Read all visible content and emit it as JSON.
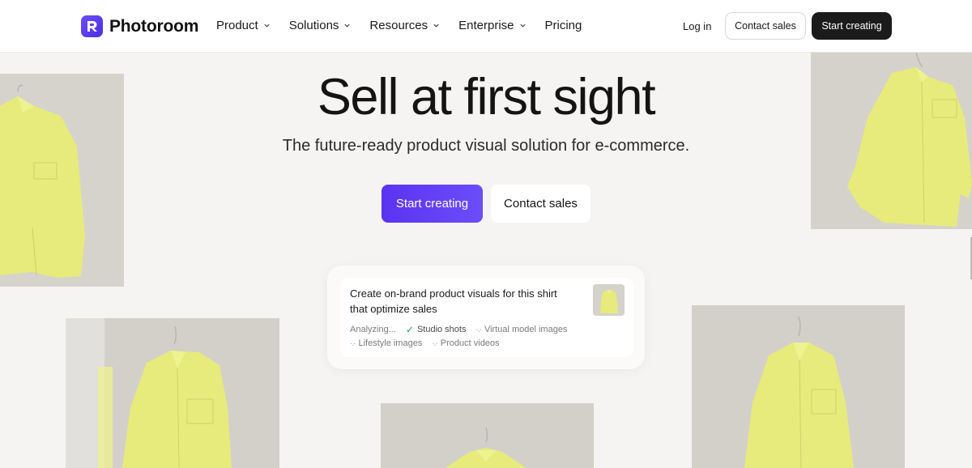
{
  "nav": {
    "logo_text": "Photoroom",
    "menu": [
      {
        "label": "Product",
        "has_dropdown": true
      },
      {
        "label": "Solutions",
        "has_dropdown": true
      },
      {
        "label": "Resources",
        "has_dropdown": true
      },
      {
        "label": "Enterprise",
        "has_dropdown": true
      },
      {
        "label": "Pricing",
        "has_dropdown": false
      }
    ],
    "login": "Log in",
    "contact_sales": "Contact sales",
    "start_creating": "Start creating"
  },
  "hero": {
    "title": "Sell at first sight",
    "subtitle": "The future-ready product visual solution for e-commerce.",
    "primary_cta": "Start creating",
    "secondary_cta": "Contact sales"
  },
  "prompt_card": {
    "prompt": "Create on-brand product visuals for this shirt that optimize sales",
    "status": "Analyzing...",
    "tags": [
      {
        "label": "Studio shots",
        "state": "done"
      },
      {
        "label": "Virtual model images",
        "state": "pending"
      },
      {
        "label": "Lifestyle images",
        "state": "pending"
      },
      {
        "label": "Product videos",
        "state": "pending"
      }
    ]
  },
  "colors": {
    "brand": "#5a33f0",
    "dark_button": "#1b1b1b",
    "background": "#f5f4f2",
    "shirt": "#e8ec7c"
  }
}
